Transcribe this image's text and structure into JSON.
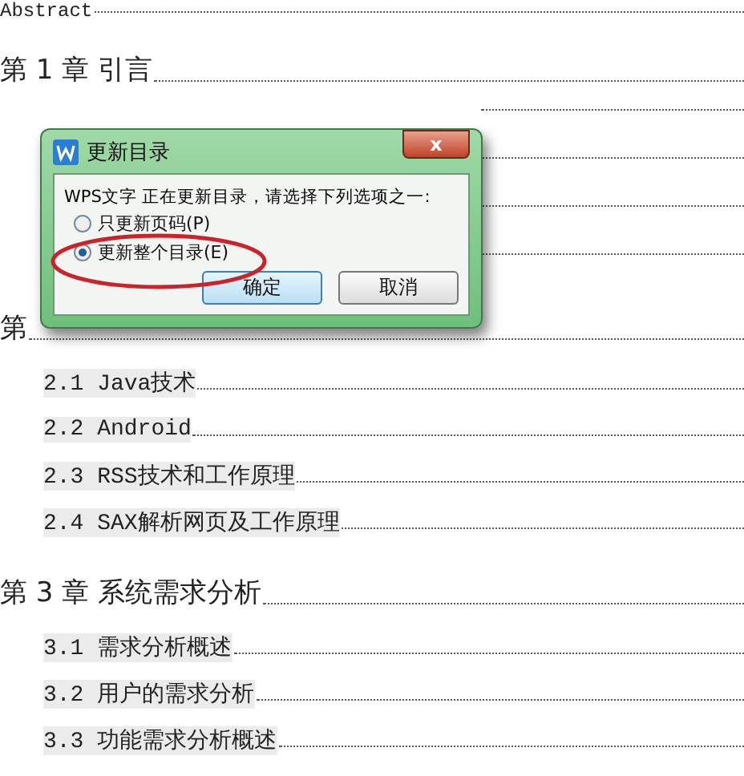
{
  "document": {
    "abstract": "Abstract",
    "chapters": [
      {
        "title": "第 1 章 引言"
      },
      {
        "title": "第",
        "sections": [
          "2.1 Java技术",
          "2.2 Android",
          "2.3 RSS技术和工作原理",
          "2.4 SAX解析网页及工作原理"
        ]
      },
      {
        "title": "第 3 章 系统需求分析",
        "sections": [
          "3.1 需求分析概述",
          "3.2 用户的需求分析",
          "3.3 功能需求分析概述"
        ]
      }
    ]
  },
  "dialog": {
    "title": "更新目录",
    "close": "x",
    "message": "WPS文字 正在更新目录，请选择下列选项之一:",
    "options": [
      {
        "label": "只更新页码(P)",
        "selected": false
      },
      {
        "label": "更新整个目录(E)",
        "selected": true
      }
    ],
    "buttons": [
      {
        "label": "确定",
        "default": true
      },
      {
        "label": "取消",
        "default": false
      }
    ]
  }
}
